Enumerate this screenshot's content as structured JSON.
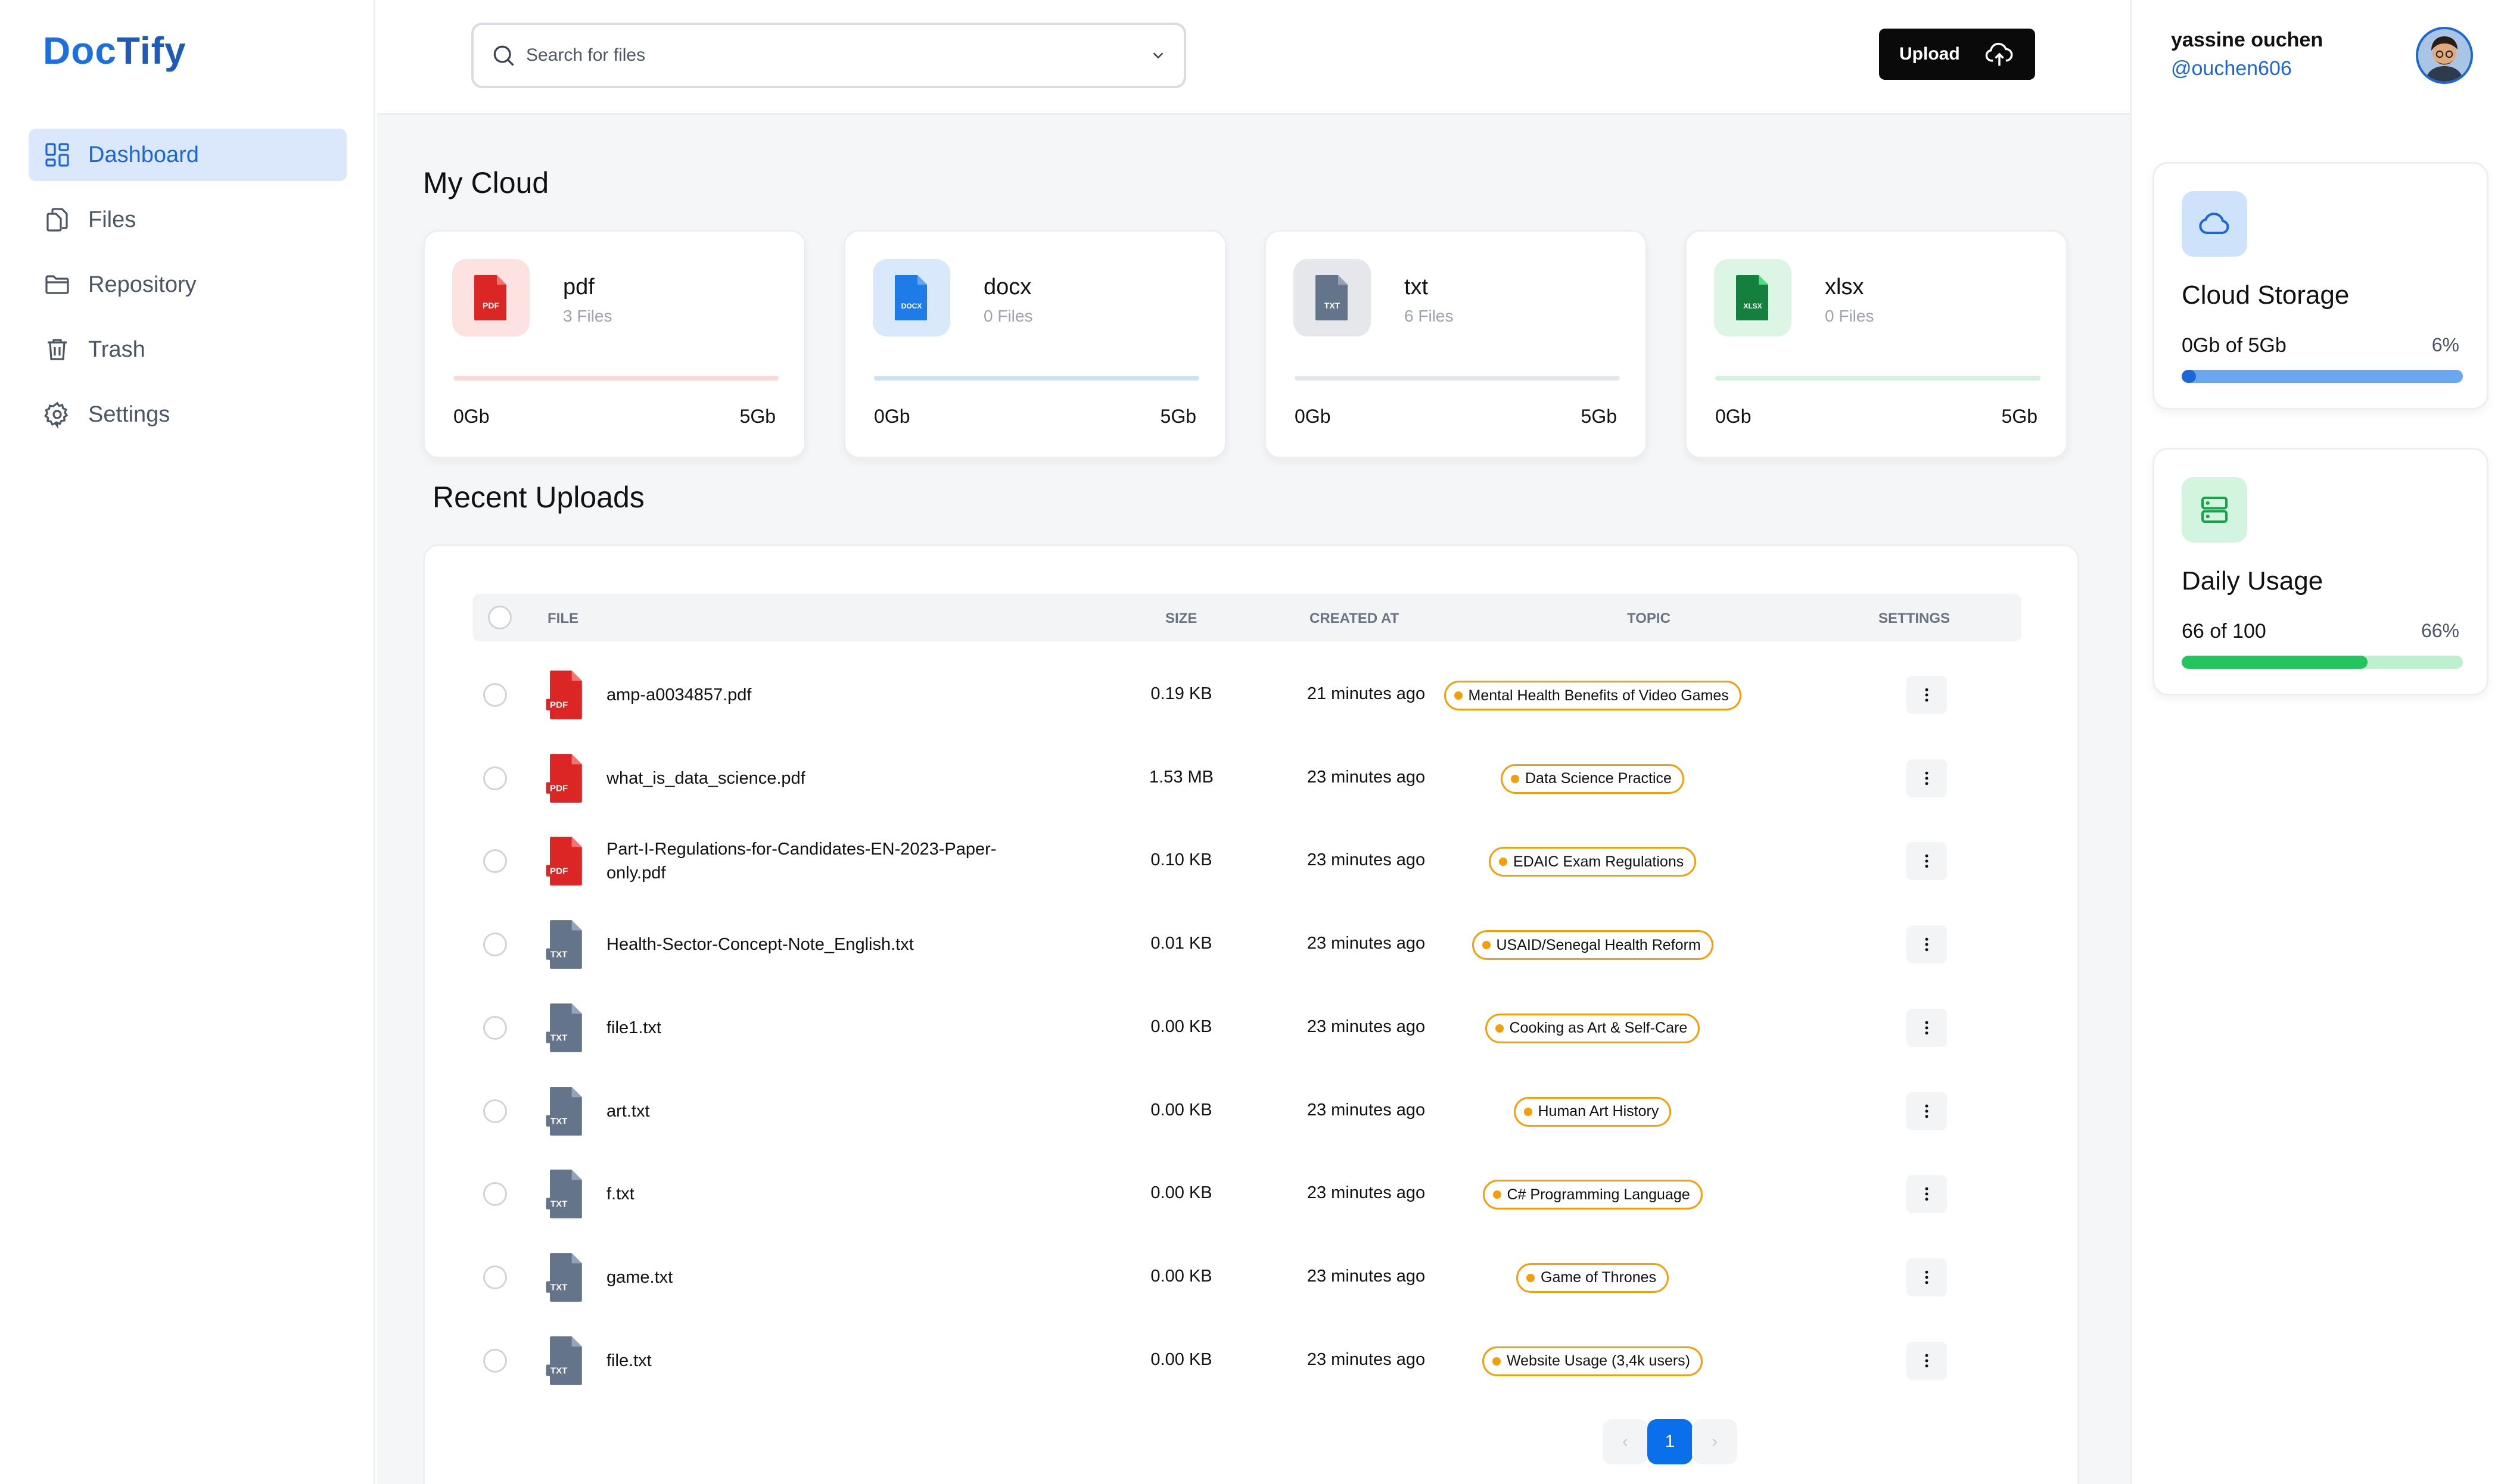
{
  "brand": {
    "part1": "Doc",
    "part2": "Tify"
  },
  "nav": {
    "dashboard": "Dashboard",
    "files": "Files",
    "repository": "Repository",
    "trash": "Trash",
    "settings": "Settings"
  },
  "search": {
    "placeholder": "Search for files"
  },
  "upload": {
    "label": "Upload"
  },
  "user": {
    "name": "yassine ouchen",
    "handle": "@ouchen606"
  },
  "my_cloud": {
    "title": "My Cloud",
    "cards": [
      {
        "type": "pdf",
        "files": "3 Files",
        "used": "0Gb",
        "total": "5Gb",
        "badge": "PDF",
        "color": "#dc2626",
        "bg": "#fde2e2"
      },
      {
        "type": "docx",
        "files": "0 Files",
        "used": "0Gb",
        "total": "5Gb",
        "badge": "DOCX",
        "color": "#1e7be8",
        "bg": "#d9e8fb"
      },
      {
        "type": "txt",
        "files": "6 Files",
        "used": "0Gb",
        "total": "5Gb",
        "badge": "TXT",
        "color": "#64748b",
        "bg": "#e5e7eb"
      },
      {
        "type": "xlsx",
        "files": "0 Files",
        "used": "0Gb",
        "total": "5Gb",
        "badge": "XLSX",
        "color": "#15803d",
        "bg": "#dcf5e5"
      }
    ]
  },
  "recent": {
    "title": "Recent Uploads",
    "columns": {
      "file": "FILE",
      "size": "SIZE",
      "created": "CREATED AT",
      "topic": "TOPIC",
      "settings": "SETTINGS"
    },
    "rows": [
      {
        "type": "PDF",
        "name": "amp-a0034857.pdf",
        "size": "0.19 KB",
        "created": "21 minutes ago",
        "topic": "Mental Health Benefits of Video Games"
      },
      {
        "type": "PDF",
        "name": "what_is_data_science.pdf",
        "size": "1.53 MB",
        "created": "23 minutes ago",
        "topic": "Data Science Practice"
      },
      {
        "type": "PDF",
        "name": "Part-I-Regulations-for-Candidates-EN-2023-Paper-only.pdf",
        "size": "0.10 KB",
        "created": "23 minutes ago",
        "topic": "EDAIC Exam Regulations"
      },
      {
        "type": "TXT",
        "name": "Health-Sector-Concept-Note_English.txt",
        "size": "0.01 KB",
        "created": "23 minutes ago",
        "topic": "USAID/Senegal Health Reform"
      },
      {
        "type": "TXT",
        "name": "file1.txt",
        "size": "0.00 KB",
        "created": "23 minutes ago",
        "topic": "Cooking as Art & Self-Care"
      },
      {
        "type": "TXT",
        "name": "art.txt",
        "size": "0.00 KB",
        "created": "23 minutes ago",
        "topic": "Human Art History"
      },
      {
        "type": "TXT",
        "name": "f.txt",
        "size": "0.00 KB",
        "created": "23 minutes ago",
        "topic": "C# Programming Language"
      },
      {
        "type": "TXT",
        "name": "game.txt",
        "size": "0.00 KB",
        "created": "23 minutes ago",
        "topic": "Game of Thrones"
      },
      {
        "type": "TXT",
        "name": "file.txt",
        "size": "0.00 KB",
        "created": "23 minutes ago",
        "topic": "Website Usage (3,4k users)"
      }
    ]
  },
  "pagination": {
    "current": "1",
    "prev": "‹",
    "next": "›"
  },
  "cloud_storage": {
    "title": "Cloud Storage",
    "value": "0Gb of 5Gb",
    "percent": "6%",
    "fraction": 0.03,
    "fill": "#6ba7f0",
    "track": "#d6e6fb",
    "dot": "#1d66d6"
  },
  "daily_usage": {
    "title": "Daily Usage",
    "value": "66 of 100",
    "percent": "66%",
    "fraction": 0.66,
    "fill": "#22c55e",
    "track": "#bdf0cf"
  }
}
